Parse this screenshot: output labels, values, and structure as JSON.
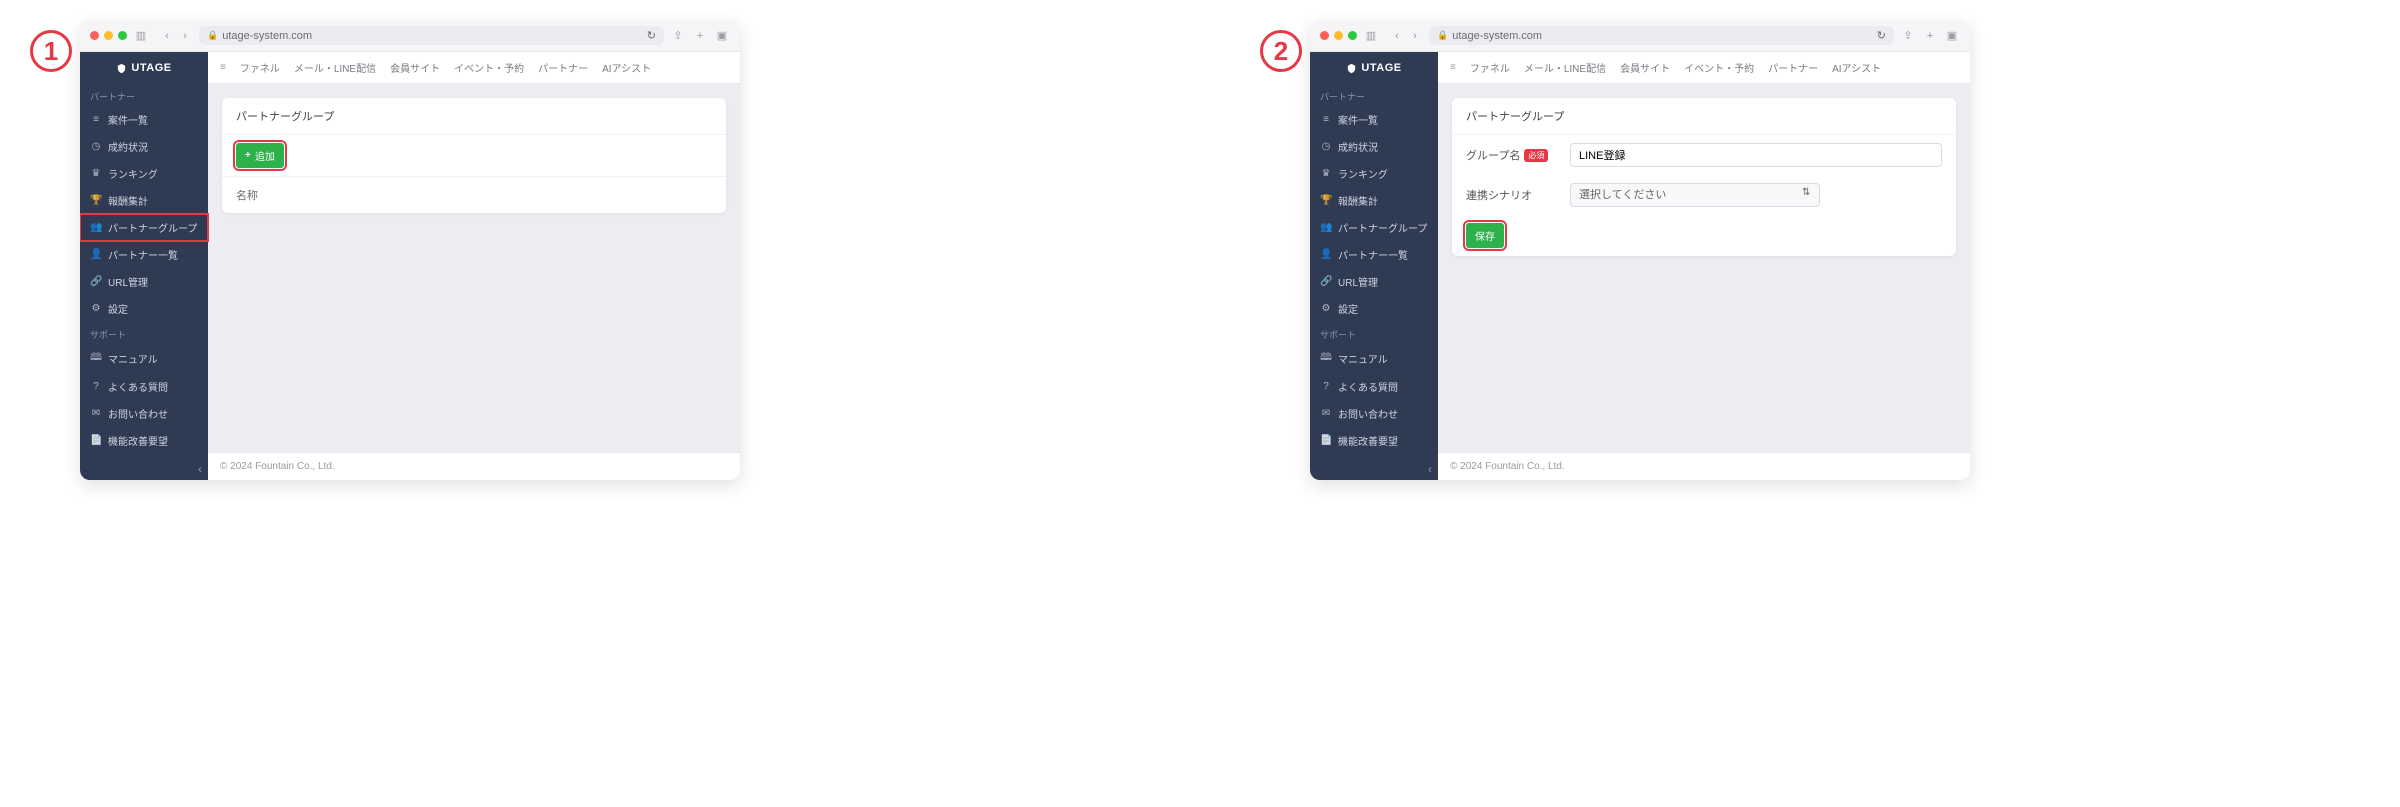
{
  "steps": {
    "one": "1",
    "two": "2"
  },
  "browser": {
    "url": "utage-system.com",
    "reload_icon": "↻",
    "share_icon": "⇪",
    "plus_icon": "+",
    "tabs_icon": "▣"
  },
  "app": {
    "brand": "UTAGE"
  },
  "sidebar": {
    "section_partner": "パートナー",
    "items_partner": [
      {
        "icon": "≡",
        "label": "案件一覧"
      },
      {
        "icon": "◷",
        "label": "成約状況"
      },
      {
        "icon": "♛",
        "label": "ランキング"
      },
      {
        "icon": "🏆",
        "label": "報酬集計"
      },
      {
        "icon": "👥",
        "label": "パートナーグループ"
      },
      {
        "icon": "👤",
        "label": "パートナー一覧"
      },
      {
        "icon": "🔗",
        "label": "URL管理"
      },
      {
        "icon": "⚙",
        "label": "設定"
      }
    ],
    "section_support": "サポート",
    "items_support": [
      {
        "icon": "🕮",
        "label": "マニュアル"
      },
      {
        "icon": "?",
        "label": "よくある質問"
      },
      {
        "icon": "✉",
        "label": "お問い合わせ"
      },
      {
        "icon": "📄",
        "label": "機能改善要望"
      }
    ],
    "collapse_icon": "‹"
  },
  "topnav": {
    "items": [
      "ファネル",
      "メール・LINE配信",
      "会員サイト",
      "イベント・予約",
      "パートナー",
      "AIアシスト"
    ]
  },
  "panel1": {
    "card_title": "パートナーグループ",
    "add_button": "追加",
    "add_plus": "+",
    "col_name": "名称"
  },
  "panel2": {
    "card_title": "パートナーグループ",
    "label_group_name": "グループ名",
    "required": "必須",
    "input_group_name_value": "LINE登録",
    "label_scenario": "連携シナリオ",
    "select_placeholder": "選択してください",
    "save_button": "保存"
  },
  "footer": "© 2024 Fountain Co., Ltd."
}
